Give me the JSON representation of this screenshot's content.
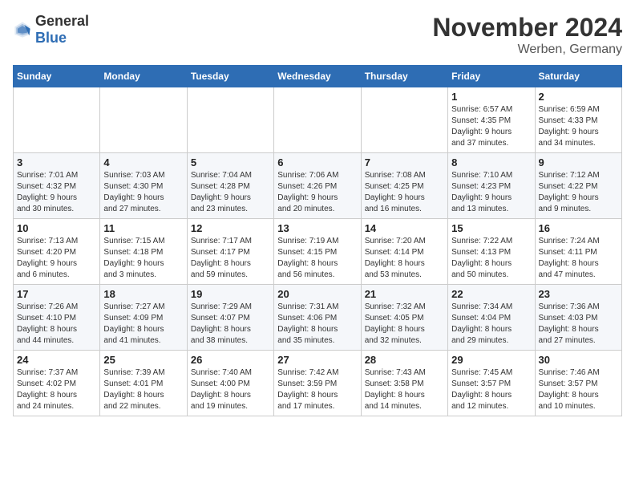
{
  "logo": {
    "text_general": "General",
    "text_blue": "Blue"
  },
  "header": {
    "month_title": "November 2024",
    "location": "Werben, Germany"
  },
  "days_of_week": [
    "Sunday",
    "Monday",
    "Tuesday",
    "Wednesday",
    "Thursday",
    "Friday",
    "Saturday"
  ],
  "weeks": [
    [
      {
        "day": "",
        "info": ""
      },
      {
        "day": "",
        "info": ""
      },
      {
        "day": "",
        "info": ""
      },
      {
        "day": "",
        "info": ""
      },
      {
        "day": "",
        "info": ""
      },
      {
        "day": "1",
        "info": "Sunrise: 6:57 AM\nSunset: 4:35 PM\nDaylight: 9 hours\nand 37 minutes."
      },
      {
        "day": "2",
        "info": "Sunrise: 6:59 AM\nSunset: 4:33 PM\nDaylight: 9 hours\nand 34 minutes."
      }
    ],
    [
      {
        "day": "3",
        "info": "Sunrise: 7:01 AM\nSunset: 4:32 PM\nDaylight: 9 hours\nand 30 minutes."
      },
      {
        "day": "4",
        "info": "Sunrise: 7:03 AM\nSunset: 4:30 PM\nDaylight: 9 hours\nand 27 minutes."
      },
      {
        "day": "5",
        "info": "Sunrise: 7:04 AM\nSunset: 4:28 PM\nDaylight: 9 hours\nand 23 minutes."
      },
      {
        "day": "6",
        "info": "Sunrise: 7:06 AM\nSunset: 4:26 PM\nDaylight: 9 hours\nand 20 minutes."
      },
      {
        "day": "7",
        "info": "Sunrise: 7:08 AM\nSunset: 4:25 PM\nDaylight: 9 hours\nand 16 minutes."
      },
      {
        "day": "8",
        "info": "Sunrise: 7:10 AM\nSunset: 4:23 PM\nDaylight: 9 hours\nand 13 minutes."
      },
      {
        "day": "9",
        "info": "Sunrise: 7:12 AM\nSunset: 4:22 PM\nDaylight: 9 hours\nand 9 minutes."
      }
    ],
    [
      {
        "day": "10",
        "info": "Sunrise: 7:13 AM\nSunset: 4:20 PM\nDaylight: 9 hours\nand 6 minutes."
      },
      {
        "day": "11",
        "info": "Sunrise: 7:15 AM\nSunset: 4:18 PM\nDaylight: 9 hours\nand 3 minutes."
      },
      {
        "day": "12",
        "info": "Sunrise: 7:17 AM\nSunset: 4:17 PM\nDaylight: 8 hours\nand 59 minutes."
      },
      {
        "day": "13",
        "info": "Sunrise: 7:19 AM\nSunset: 4:15 PM\nDaylight: 8 hours\nand 56 minutes."
      },
      {
        "day": "14",
        "info": "Sunrise: 7:20 AM\nSunset: 4:14 PM\nDaylight: 8 hours\nand 53 minutes."
      },
      {
        "day": "15",
        "info": "Sunrise: 7:22 AM\nSunset: 4:13 PM\nDaylight: 8 hours\nand 50 minutes."
      },
      {
        "day": "16",
        "info": "Sunrise: 7:24 AM\nSunset: 4:11 PM\nDaylight: 8 hours\nand 47 minutes."
      }
    ],
    [
      {
        "day": "17",
        "info": "Sunrise: 7:26 AM\nSunset: 4:10 PM\nDaylight: 8 hours\nand 44 minutes."
      },
      {
        "day": "18",
        "info": "Sunrise: 7:27 AM\nSunset: 4:09 PM\nDaylight: 8 hours\nand 41 minutes."
      },
      {
        "day": "19",
        "info": "Sunrise: 7:29 AM\nSunset: 4:07 PM\nDaylight: 8 hours\nand 38 minutes."
      },
      {
        "day": "20",
        "info": "Sunrise: 7:31 AM\nSunset: 4:06 PM\nDaylight: 8 hours\nand 35 minutes."
      },
      {
        "day": "21",
        "info": "Sunrise: 7:32 AM\nSunset: 4:05 PM\nDaylight: 8 hours\nand 32 minutes."
      },
      {
        "day": "22",
        "info": "Sunrise: 7:34 AM\nSunset: 4:04 PM\nDaylight: 8 hours\nand 29 minutes."
      },
      {
        "day": "23",
        "info": "Sunrise: 7:36 AM\nSunset: 4:03 PM\nDaylight: 8 hours\nand 27 minutes."
      }
    ],
    [
      {
        "day": "24",
        "info": "Sunrise: 7:37 AM\nSunset: 4:02 PM\nDaylight: 8 hours\nand 24 minutes."
      },
      {
        "day": "25",
        "info": "Sunrise: 7:39 AM\nSunset: 4:01 PM\nDaylight: 8 hours\nand 22 minutes."
      },
      {
        "day": "26",
        "info": "Sunrise: 7:40 AM\nSunset: 4:00 PM\nDaylight: 8 hours\nand 19 minutes."
      },
      {
        "day": "27",
        "info": "Sunrise: 7:42 AM\nSunset: 3:59 PM\nDaylight: 8 hours\nand 17 minutes."
      },
      {
        "day": "28",
        "info": "Sunrise: 7:43 AM\nSunset: 3:58 PM\nDaylight: 8 hours\nand 14 minutes."
      },
      {
        "day": "29",
        "info": "Sunrise: 7:45 AM\nSunset: 3:57 PM\nDaylight: 8 hours\nand 12 minutes."
      },
      {
        "day": "30",
        "info": "Sunrise: 7:46 AM\nSunset: 3:57 PM\nDaylight: 8 hours\nand 10 minutes."
      }
    ]
  ]
}
